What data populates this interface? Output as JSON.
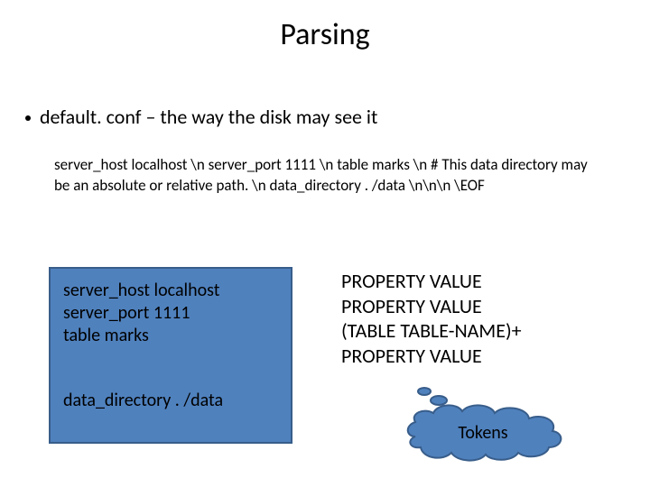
{
  "title": "Parsing",
  "bullet": "default. conf – the way the disk may see it",
  "paragraph": "server_host localhost \\n server_port 1111 \\n table marks \\n # This data directory  may be an absolute or relative path. \\n data_directory . /data \\n\\n\\n \\EOF",
  "box": {
    "line1": "server_host localhost",
    "line2": "server_port 1111",
    "line3": "table marks",
    "line4": "data_directory . /data"
  },
  "grammar": {
    "line1": "PROPERTY  VALUE",
    "line2": "PROPERTY  VALUE",
    "line3": "(TABLE  TABLE-NAME)+",
    "line4": "PROPERTY  VALUE"
  },
  "cloud_label": "Tokens",
  "colors": {
    "box_fill": "#4f81bd",
    "box_border": "#385d8a"
  }
}
